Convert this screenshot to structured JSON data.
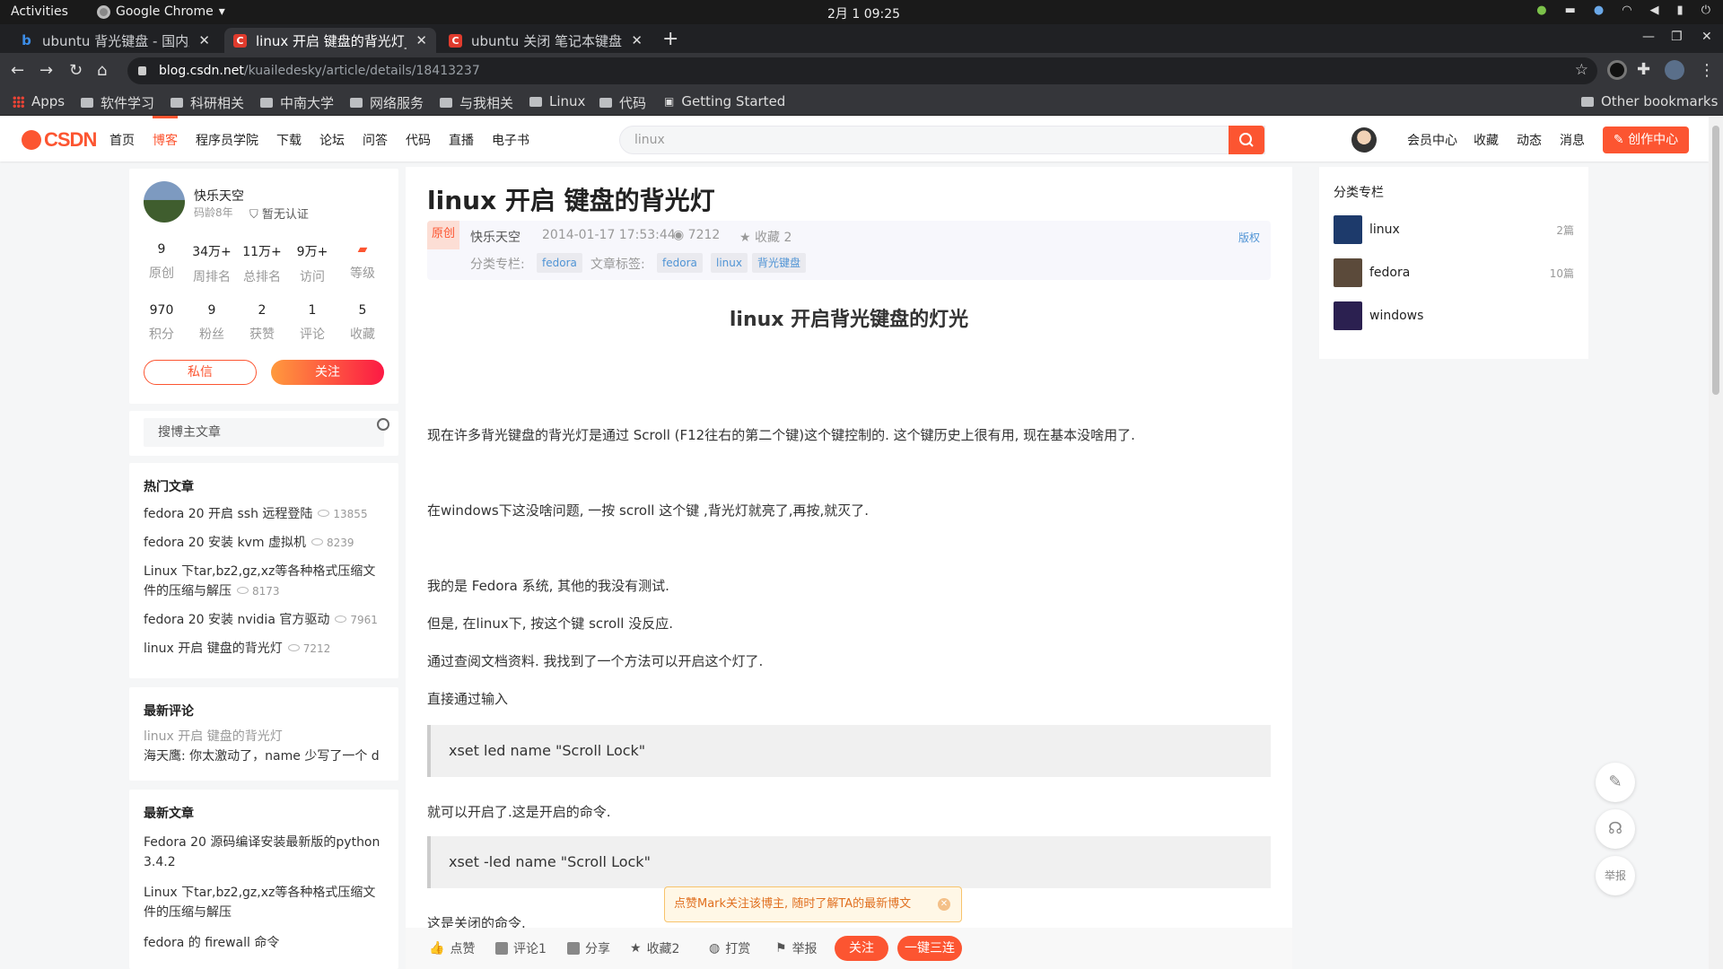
{
  "system": {
    "activities": "Activities",
    "app_name": "Google Chrome",
    "clock": "2月 1  09:25"
  },
  "tabs": [
    {
      "title": "ubuntu 背光键盘 - 国内版",
      "active": false
    },
    {
      "title": "linux 开启 键盘的背光灯_k",
      "active": true
    },
    {
      "title": "ubuntu 关闭 笔记本键盘背",
      "active": false
    }
  ],
  "omnibox": {
    "host": "blog.csdn.net",
    "path": "/kuailedesky/article/details/18413237"
  },
  "bookmarks": {
    "items": [
      "Apps",
      "软件学习",
      "科研相关",
      "中南大学",
      "网络服务",
      "与我相关",
      "Linux",
      "代码",
      "Getting Started"
    ],
    "other": "Other bookmarks"
  },
  "csdn_header": {
    "logo": "CSDN",
    "nav": [
      "首页",
      "博客",
      "程序员学院",
      "下载",
      "论坛",
      "问答",
      "代码",
      "直播",
      "电子书"
    ],
    "search_placeholder": "linux",
    "links": [
      "会员中心",
      "收藏",
      "动态",
      "消息"
    ],
    "create_button": "创作中心"
  },
  "profile": {
    "name": "快乐天空",
    "code_age": "码龄8年",
    "cert": "暂无认证",
    "stats_row1": [
      {
        "n": "9",
        "l": "原创"
      },
      {
        "n": "34万+",
        "l": "周排名"
      },
      {
        "n": "11万+",
        "l": "总排名"
      },
      {
        "n": "9万+",
        "l": "访问"
      },
      {
        "n": "",
        "l": "等级"
      }
    ],
    "stats_row2": [
      {
        "n": "970",
        "l": "积分"
      },
      {
        "n": "9",
        "l": "粉丝"
      },
      {
        "n": "2",
        "l": "获赞"
      },
      {
        "n": "1",
        "l": "评论"
      },
      {
        "n": "5",
        "l": "收藏"
      }
    ],
    "message_button": "私信",
    "follow_button": "关注"
  },
  "blog_search": {
    "placeholder": "搜博主文章"
  },
  "hot_articles": {
    "title": "热门文章",
    "items": [
      {
        "title": "fedora 20 开启 ssh 远程登陆",
        "views": "13855"
      },
      {
        "title": "fedora 20 安装 kvm 虚拟机",
        "views": "8239"
      },
      {
        "title": "Linux 下tar,bz2,gz,xz等各种格式压缩文件的压缩与解压",
        "views": "8173"
      },
      {
        "title": "fedora 20 安装 nvidia 官方驱动",
        "views": "7961"
      },
      {
        "title": "linux 开启 键盘的背光灯",
        "views": "7212"
      }
    ]
  },
  "latest_comments": {
    "title": "最新评论",
    "article": "linux 开启 键盘的背光灯",
    "comment": "海天鹰: 你太激动了，name 少写了一个 d"
  },
  "latest_articles": {
    "title": "最新文章",
    "items": [
      "Fedora 20 源码编译安装最新版的python 3.4.2",
      "Linux 下tar,bz2,gz,xz等各种格式压缩文件的压缩与解压",
      "fedora 的 firewall 命令"
    ]
  },
  "article": {
    "title": "linux 开启 键盘的背光灯",
    "orig_tag": "原创",
    "author": "快乐天空",
    "date": "2014-01-17 17:53:44",
    "views": "7212",
    "favorites": "收藏 2",
    "copyright": "版权",
    "column_label": "分类专栏:",
    "column_tags": [
      "fedora"
    ],
    "article_label": "文章标签:",
    "article_tags": [
      "fedora",
      "linux",
      "背光键盘"
    ],
    "heading": "linux 开启背光键盘的灯光",
    "p1": "现在许多背光键盘的背光灯是通过 Scroll (F12往右的第二个键)这个键控制的. 这个键历史上很有用, 现在基本没啥用了.",
    "p2": "在windows下这没啥问题, 一按 scroll 这个键 ,背光灯就亮了,再按,就灭了.",
    "p3": "我的是 Fedora 系统, 其他的我没有测试.",
    "p4": "但是, 在linux下, 按这个键 scroll 没反应.",
    "p5": "通过查阅文档资料. 我找到了一个方法可以开启这个灯了.",
    "p6": "直接通过输入",
    "code1": "xset led name \"Scroll Lock\"",
    "p7": "就可以开启了.这是开启的命令.",
    "code2": "xset -led name \"Scroll Lock\"",
    "p8": "这是关闭的命令."
  },
  "toast": {
    "text": "点赞Mark关注该博主, 随时了解TA的最新博文"
  },
  "bottom_bar": {
    "like": "点赞",
    "comment": "评论1",
    "share": "分享",
    "collect": "收藏2",
    "reward": "打赏",
    "report": "举报",
    "follow": "关注",
    "triple": "一键三连"
  },
  "columns": {
    "title": "分类专栏",
    "items": [
      {
        "name": "linux",
        "count": "2篇"
      },
      {
        "name": "fedora",
        "count": "10篇"
      },
      {
        "name": "windows",
        "count": ""
      }
    ]
  },
  "float": {
    "report": "举报"
  }
}
